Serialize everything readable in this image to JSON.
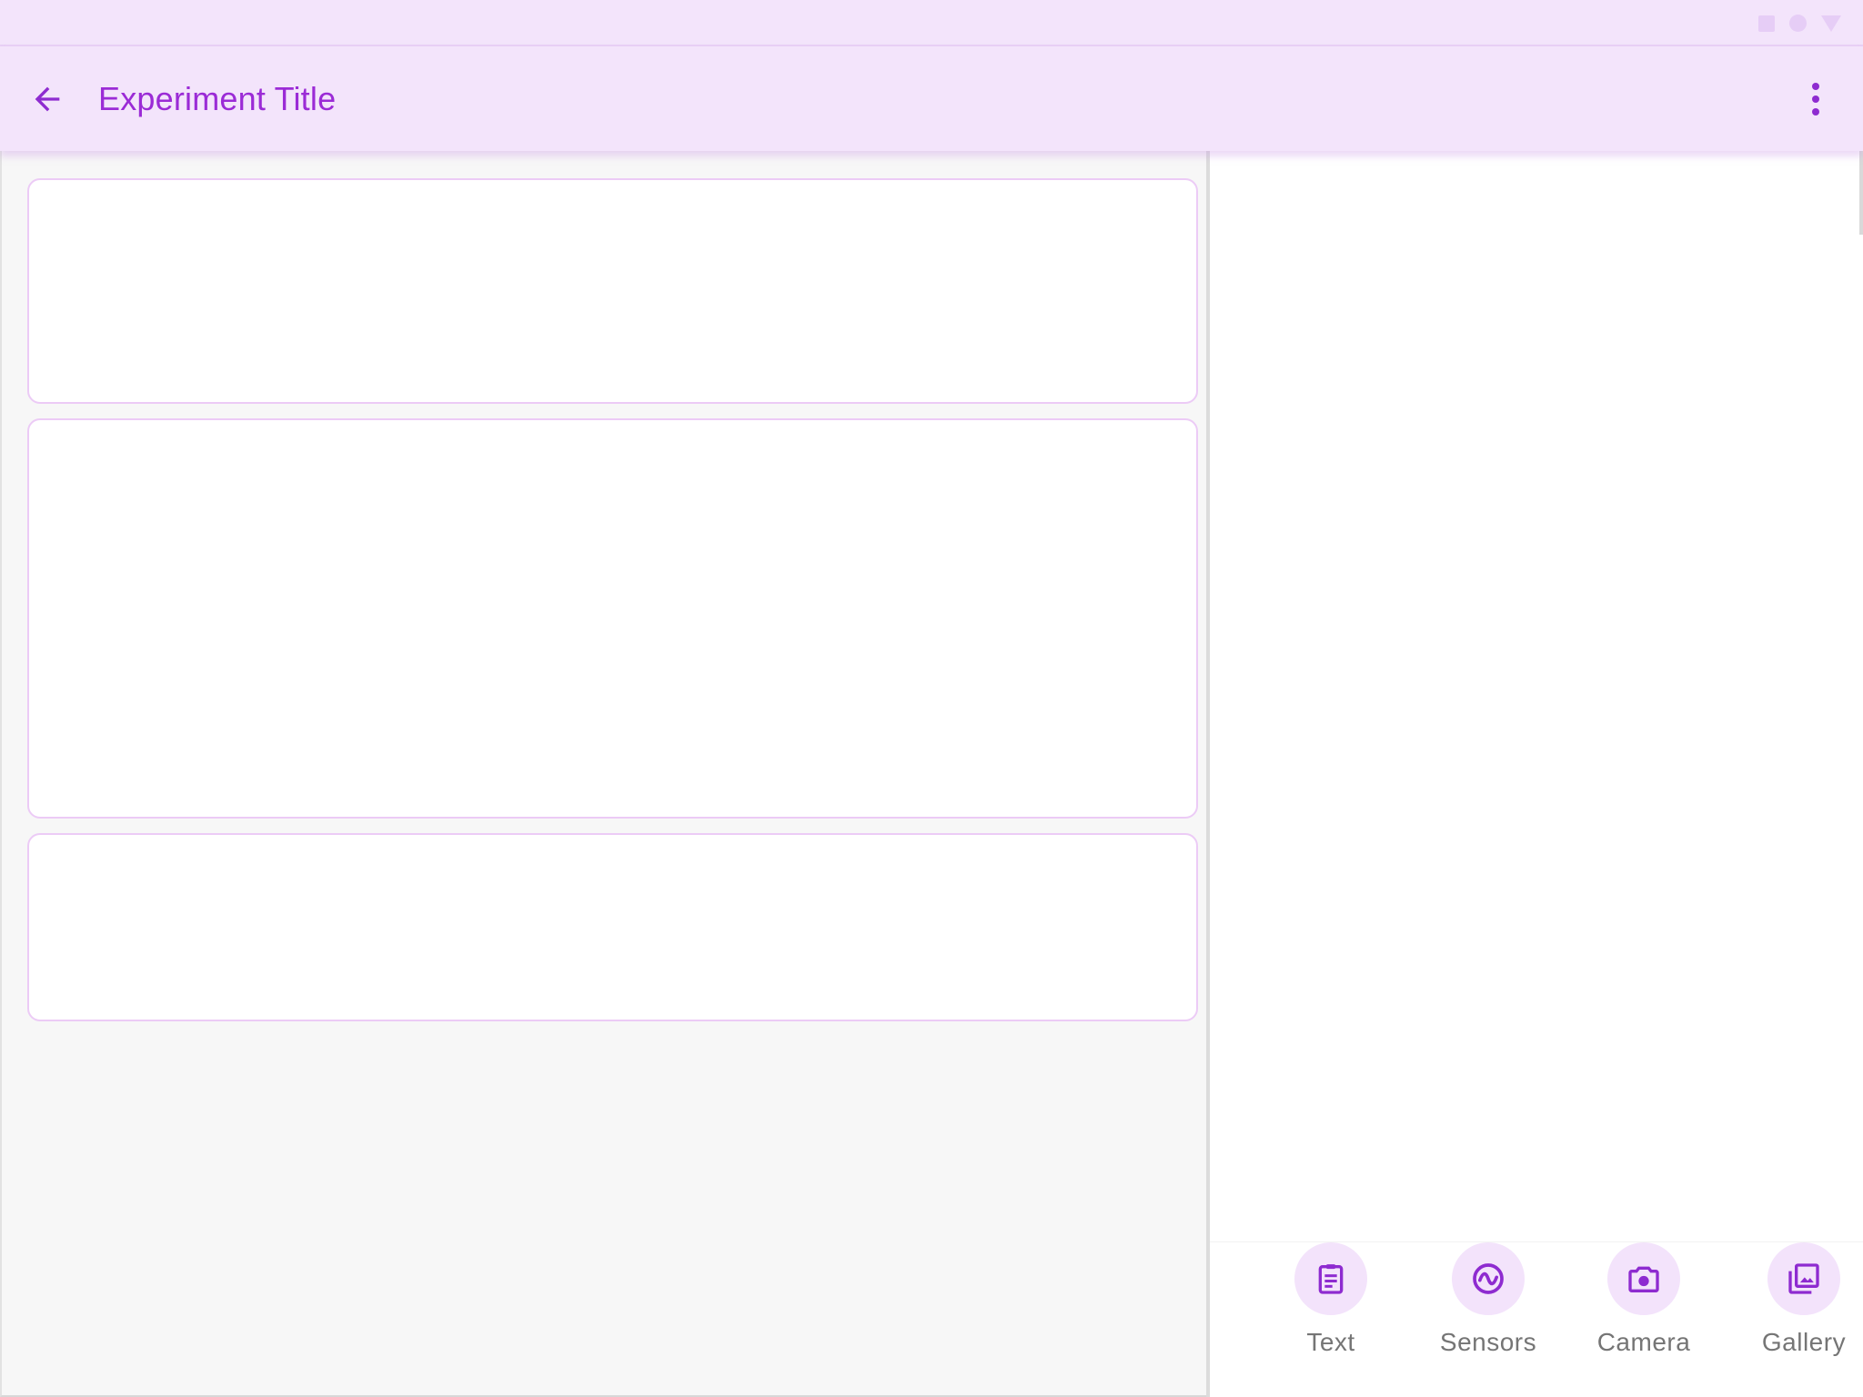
{
  "app_bar": {
    "title": "Experiment Title",
    "back_icon": "arrow-back-icon",
    "more_icon": "more-vert-icon"
  },
  "status_bar": {
    "icons": [
      "square-icon",
      "circle-icon",
      "triangle-icon"
    ]
  },
  "cards": [
    {
      "name": "card-1"
    },
    {
      "name": "card-2"
    },
    {
      "name": "card-3"
    }
  ],
  "actions": [
    {
      "label": "Text",
      "icon": "clipboard-note-icon"
    },
    {
      "label": "Sensors",
      "icon": "sensor-wave-icon"
    },
    {
      "label": "Camera",
      "icon": "camera-icon"
    },
    {
      "label": "Gallery",
      "icon": "gallery-icon"
    }
  ],
  "colors": {
    "accent": "#9b2bd6",
    "bar_background": "#f3e4fb",
    "action_circle": "#f3e3fb",
    "card_border": "#eccbf6",
    "label_gray": "#757575"
  }
}
